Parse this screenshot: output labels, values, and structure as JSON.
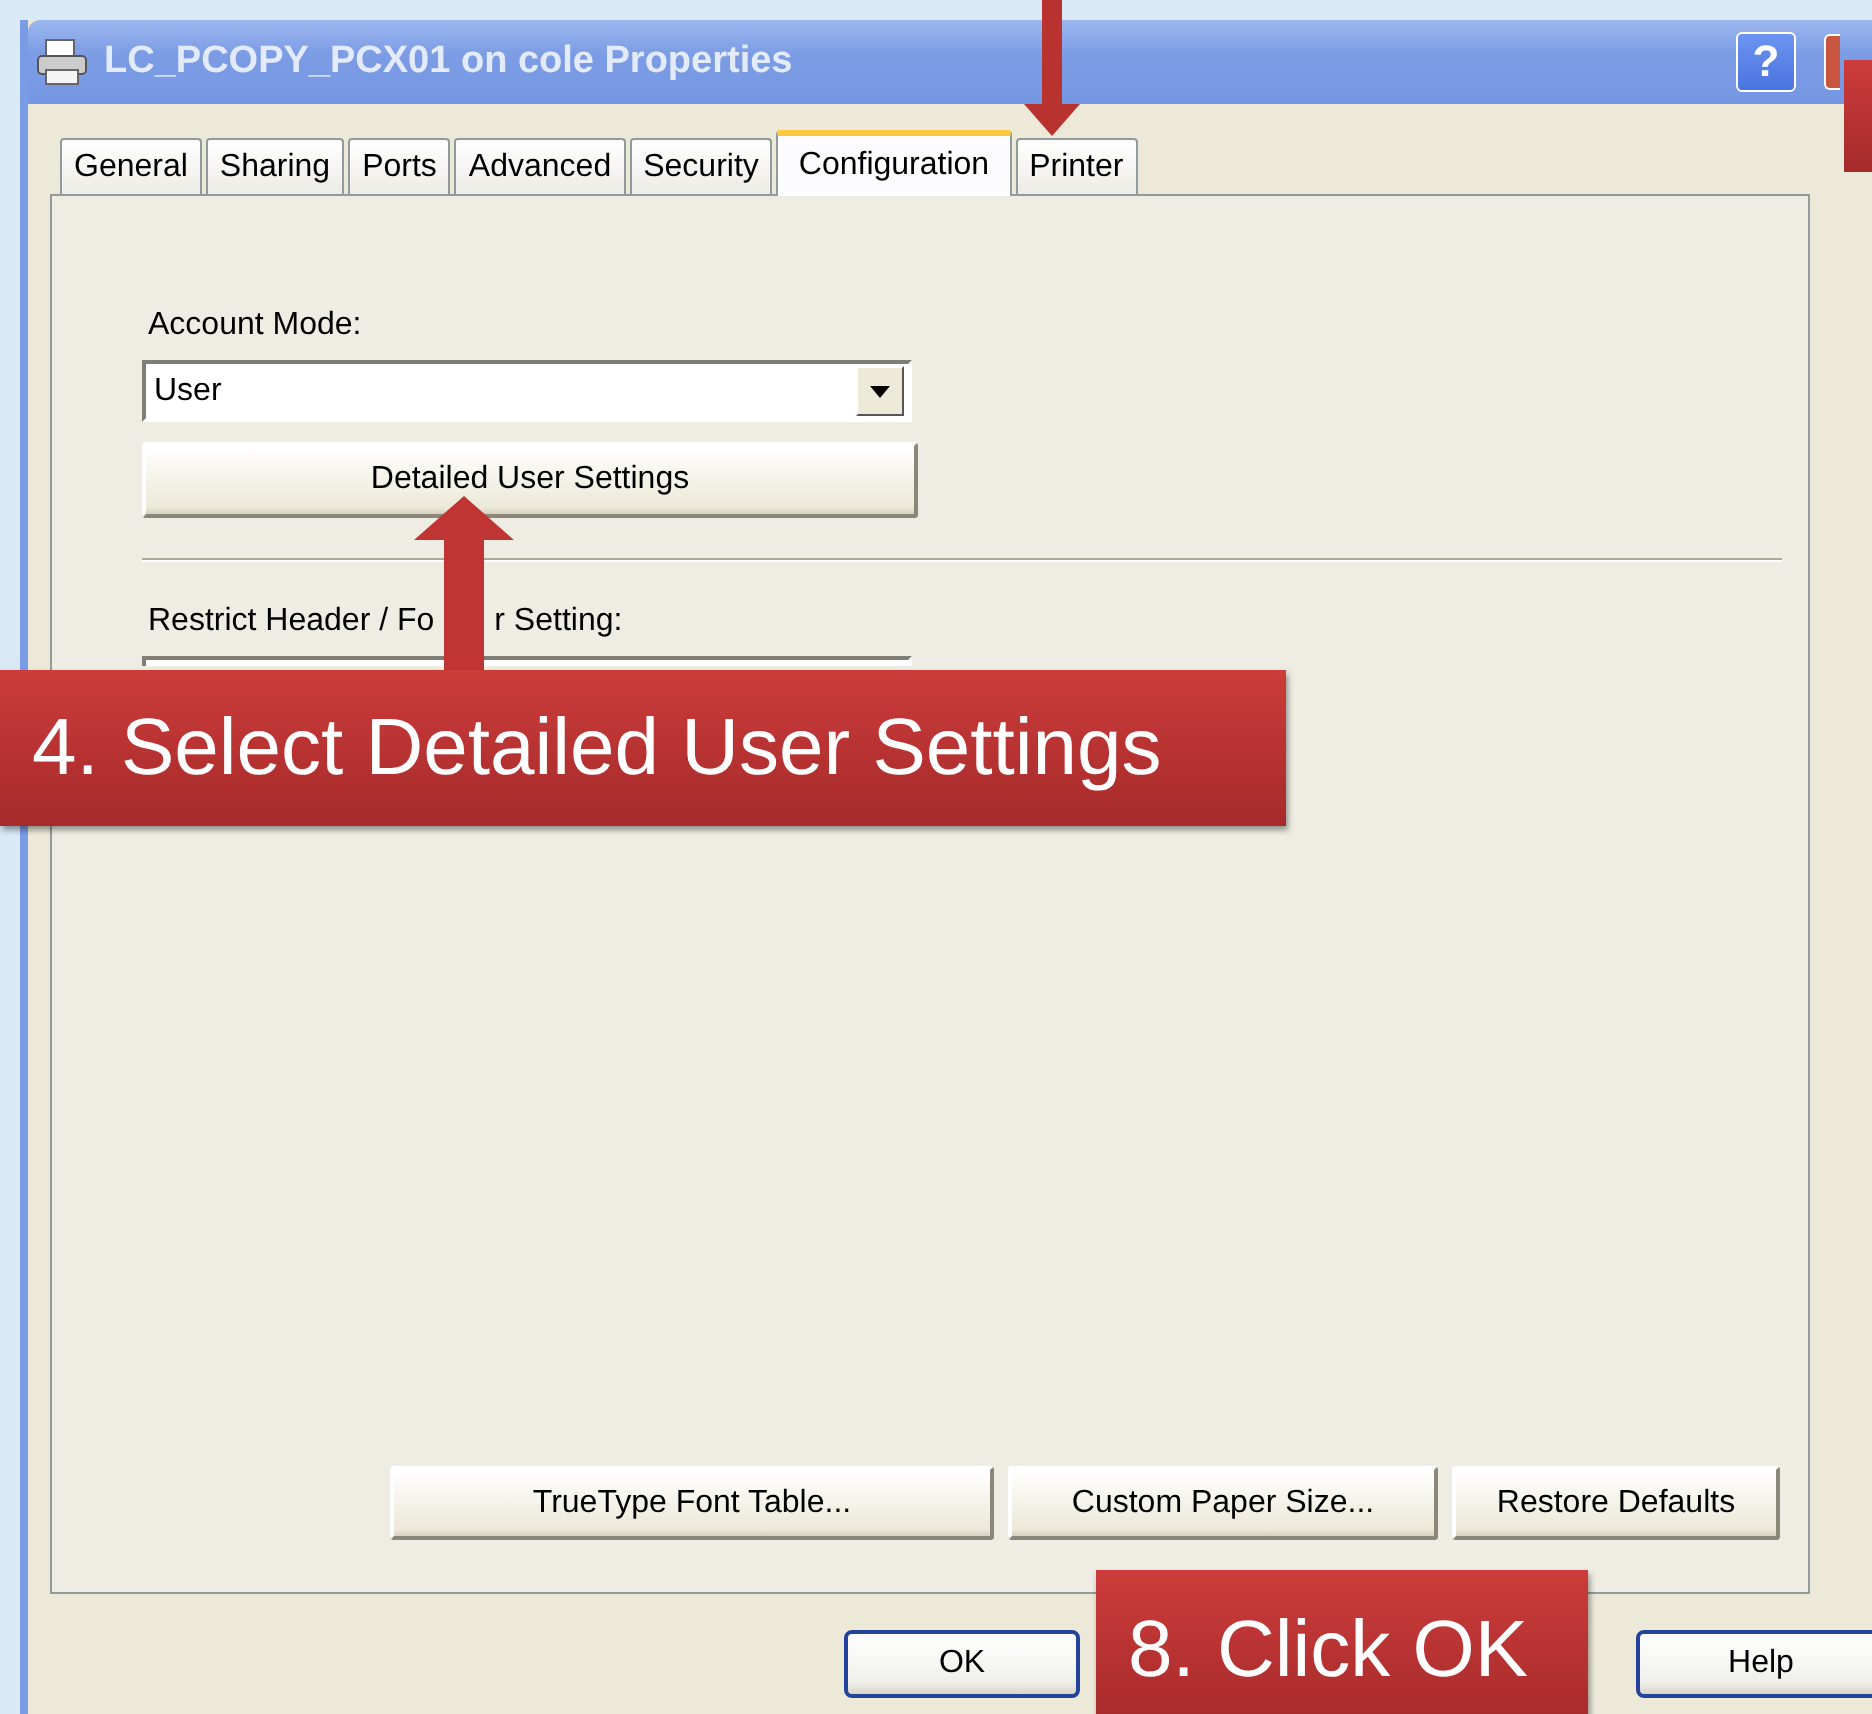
{
  "window": {
    "title": "LC_PCOPY_PCX01 on cole Properties",
    "help_button": "?"
  },
  "tabs": [
    {
      "label": "General",
      "selected": false
    },
    {
      "label": "Sharing",
      "selected": false
    },
    {
      "label": "Ports",
      "selected": false
    },
    {
      "label": "Advanced",
      "selected": false
    },
    {
      "label": "Security",
      "selected": false
    },
    {
      "label": "Configuration",
      "selected": true
    },
    {
      "label": "Printer",
      "selected": false
    }
  ],
  "account_mode": {
    "label": "Account Mode:",
    "value": "User"
  },
  "detailed_button": "Detailed User Settings",
  "restrict_header_footer": {
    "label_start": "Restrict Header / Fo",
    "label_end": "r Setting:"
  },
  "panel_buttons": [
    "TrueType Font Table...",
    "Custom Paper Size...",
    "Restore Defaults"
  ],
  "dialog_buttons": {
    "ok": "OK",
    "help": "Help"
  },
  "callouts": [
    {
      "text": "4. Select Detailed User Settings"
    },
    {
      "text": "8. Click OK"
    }
  ]
}
